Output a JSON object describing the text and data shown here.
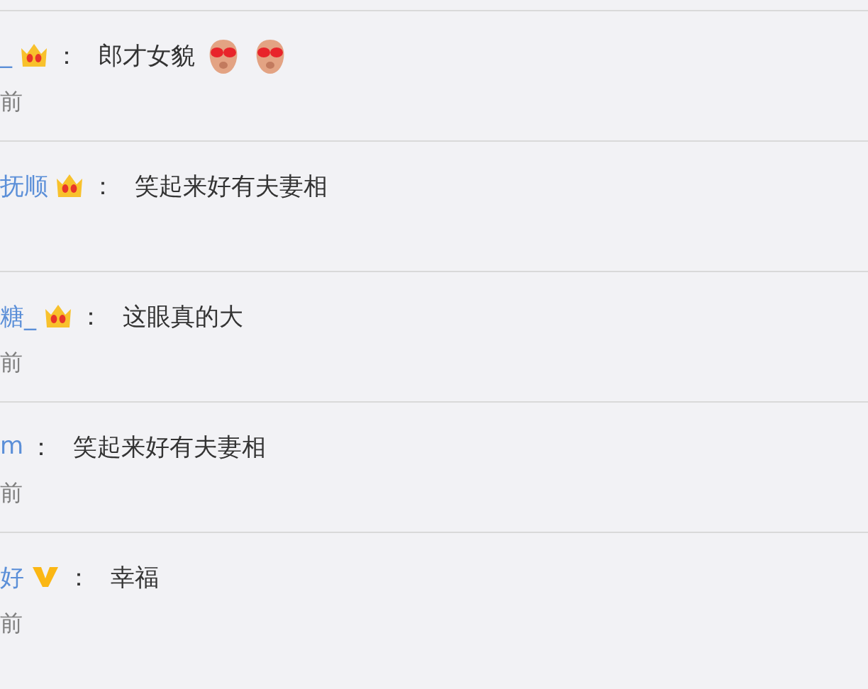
{
  "comments": [
    {
      "kind": "crown",
      "user": "_",
      "separator": "：",
      "text": "郎才女貌",
      "emojis": [
        {
          "kind": "sticker"
        },
        {
          "kind": "sticker"
        }
      ],
      "time": "前"
    },
    {
      "kind": "crown",
      "user": "抚顺",
      "separator": "：",
      "text": "笑起来好有夫妻相"
    },
    {
      "kind": "crown",
      "user": "糖_",
      "separator": "：",
      "text": "这眼真的大",
      "time": "前"
    },
    {
      "kind": "plain",
      "user": "m",
      "separator": "：",
      "text": "笑起来好有夫妻相",
      "time": "前"
    },
    {
      "kind": "vip",
      "user": "好",
      "separator": "：",
      "text": "幸福",
      "time": "前"
    }
  ]
}
